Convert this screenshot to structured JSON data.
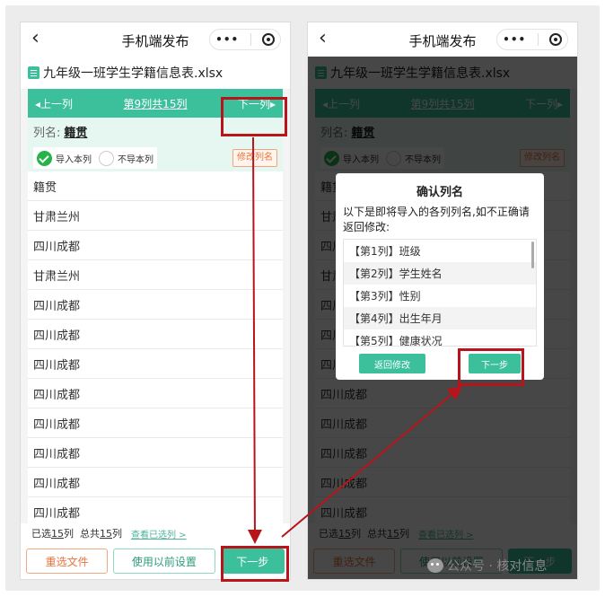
{
  "app": {
    "title": "手机端发布",
    "menu_dots": "•••"
  },
  "file": {
    "name": "九年级一班学生学籍信息表.xlsx"
  },
  "column_nav": {
    "prev": "上一列",
    "position": "第9列共15列",
    "next": "下一列"
  },
  "column": {
    "label": "列名:",
    "value": "籍贯",
    "import_option": "导入本列",
    "skip_option": "不导本列",
    "rename_button": "修改列名"
  },
  "rows": [
    "籍贯",
    "甘肃兰州",
    "四川成都",
    "甘肃兰州",
    "四川成都",
    "四川成都",
    "四川成都",
    "四川成都",
    "四川成都",
    "四川成都",
    "四川成都",
    "四川成都"
  ],
  "status": {
    "selected_prefix": "已选",
    "selected_count": "15",
    "selected_suffix": "列",
    "total_prefix": "总共",
    "total_count": "15",
    "total_suffix": "列",
    "view_selected": "查看已选列 >"
  },
  "buttons": {
    "reselect": "重选文件",
    "use_previous": "使用以前设置",
    "next_step": "下一步"
  },
  "dialog": {
    "title": "确认列名",
    "description": "以下是即将导入的各列列名,如不正确请返回修改:",
    "items": [
      "【第1列】班级",
      "【第2列】学生姓名",
      "【第3列】性别",
      "【第4列】出生年月",
      "【第5列】健康状况"
    ],
    "back_button": "返回修改",
    "next_button": "下一步"
  },
  "watermark": {
    "text": "公众号 · 核对信息"
  },
  "colors": {
    "accent": "#3cc09c",
    "highlight": "#b8141c",
    "orange": "#e8733c"
  }
}
